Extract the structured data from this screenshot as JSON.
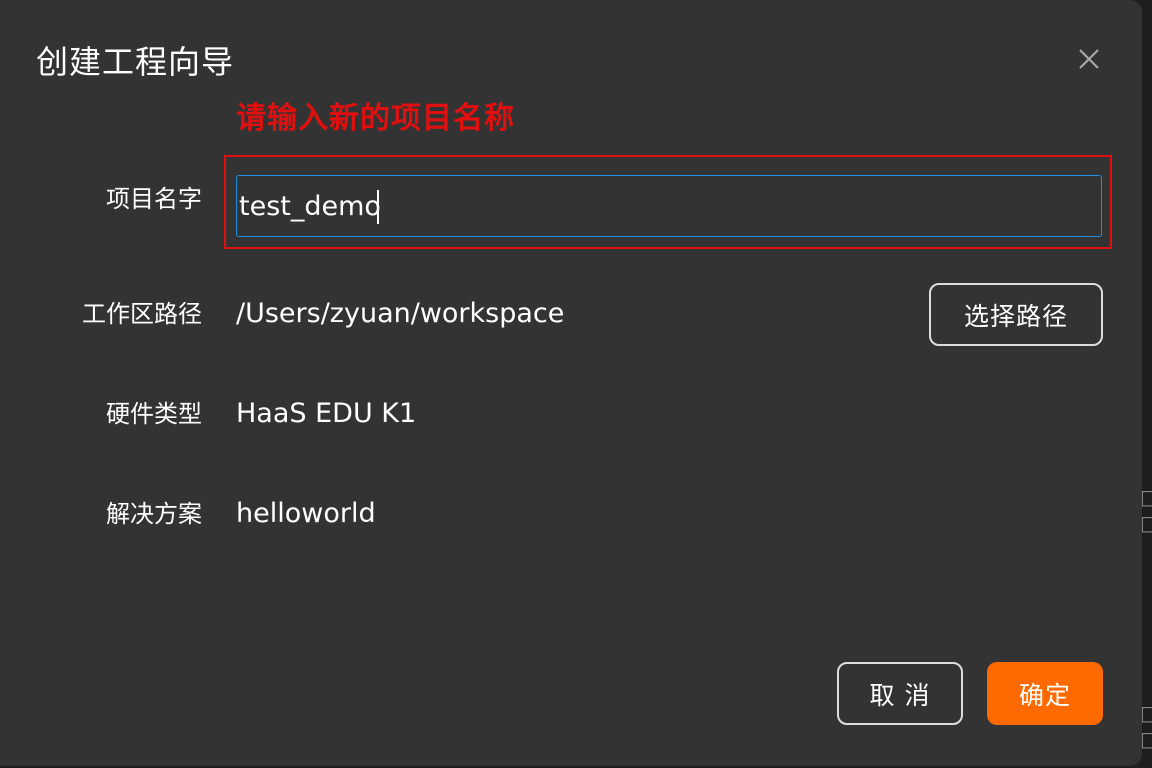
{
  "dialog": {
    "title": "创建工程向导",
    "hint": "请输入新的项目名称"
  },
  "fields": {
    "project_name": {
      "label": "项目名字",
      "value": "test_demo"
    },
    "workspace": {
      "label": "工作区路径",
      "value": "/Users/zyuan/workspace",
      "button": "选择路径"
    },
    "hardware": {
      "label": "硬件类型",
      "value": "HaaS EDU K1"
    },
    "solution": {
      "label": "解决方案",
      "value": "helloworld"
    }
  },
  "footer": {
    "cancel": "取 消",
    "confirm": "确定"
  },
  "colors": {
    "dialog_bg": "#333333",
    "accent": "#ff6a00",
    "focus_border": "#1e8fe0",
    "annotation_red": "#e01010"
  },
  "icons": {
    "close": "close-icon"
  }
}
